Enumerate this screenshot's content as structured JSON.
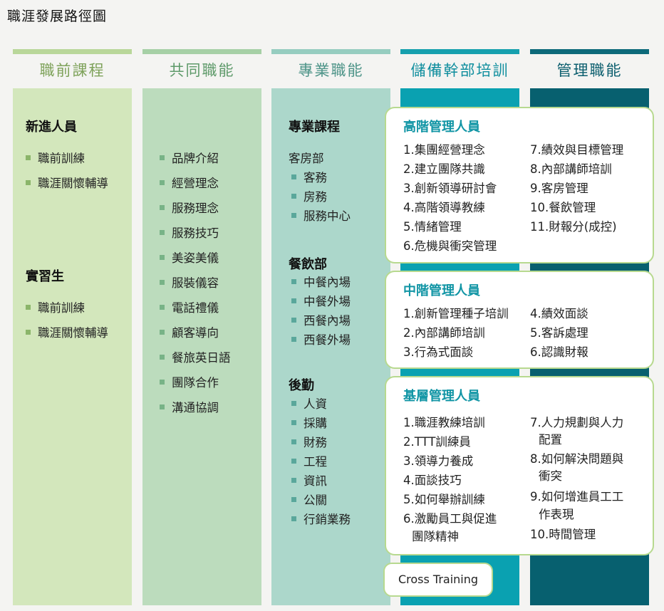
{
  "page_title": "職涯發展路徑圖",
  "columns": [
    {
      "title": "職前課程"
    },
    {
      "title": "共同職能"
    },
    {
      "title": "專業職能"
    },
    {
      "title": "儲備幹部培訓"
    },
    {
      "title": "管理職能"
    }
  ],
  "pre_job": {
    "new_staff": {
      "title": "新進人員",
      "items": [
        "職前訓練",
        "職涯關懷輔導"
      ]
    },
    "intern": {
      "title": "實習生",
      "items": [
        "職前訓練",
        "職涯關懷輔導"
      ]
    }
  },
  "common": {
    "items": [
      "品牌介紹",
      "經營理念",
      "服務理念",
      "服務技巧",
      "美姿美儀",
      "服裝儀容",
      "電話禮儀",
      "顧客導向",
      "餐旅英日語",
      "團隊合作",
      "溝通協調"
    ]
  },
  "professional": {
    "title": "專業課程",
    "rooms": {
      "title": "客房部",
      "items": [
        "客務",
        "房務",
        "服務中心"
      ]
    },
    "fnb": {
      "title": "餐飲部",
      "items": [
        "中餐內場",
        "中餐外場",
        "西餐內場",
        "西餐外場"
      ]
    },
    "backoffice": {
      "title": "後勤",
      "items": [
        "人資",
        "採購",
        "財務",
        "工程",
        "資訊",
        "公關",
        "行銷業務"
      ]
    }
  },
  "senior": {
    "title": "高階管理人員",
    "left": [
      "1.集團經營理念",
      "2.建立團隊共識",
      "3.創新領導研討會",
      "4.高階領導教練",
      "5.情緒管理",
      "6.危機與衝突管理"
    ],
    "right": [
      "7.績效與目標管理",
      "8.內部講師培訓",
      "9.客房管理",
      "10.餐飲管理",
      "11.財報分(成控)"
    ]
  },
  "middle": {
    "title": "中階管理人員",
    "left": [
      "1.創新管理種子培訓",
      "2.內部講師培訓",
      "3.行為式面談"
    ],
    "right": [
      "4.績效面談",
      "5.客訴處理",
      "6.認識財報"
    ]
  },
  "basic": {
    "title": "基層管理人員",
    "left": [
      "1.職涯教練培訓",
      "2.TTT訓練員",
      "3.領導力養成",
      "4.面談技巧",
      "5.如何舉辦訓練",
      "6.激勵員工與促進",
      "團隊精神"
    ],
    "right": [
      "7.人力規劃與人力",
      "配置",
      "8.如何解決問題與",
      "衝突",
      "9.如何增進員工工",
      "作表現",
      "10.時間管理"
    ]
  },
  "cross_training": "Cross Training"
}
